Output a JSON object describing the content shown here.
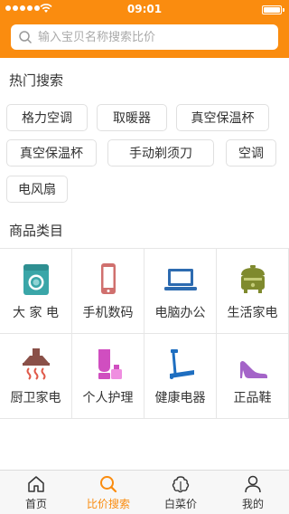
{
  "status": {
    "time": "09:01"
  },
  "search": {
    "placeholder": "输入宝贝名称搜索比价"
  },
  "hot": {
    "title": "热门搜索",
    "items": [
      "格力空调",
      "取暖器",
      "真空保温杯",
      "真空保温杯",
      "手动剃须刀",
      "空调",
      "电风扇"
    ]
  },
  "categories": {
    "title": "商品类目",
    "items": [
      {
        "label": "大 家 电",
        "icon": "washing-machine-icon",
        "color": "#3aa6a8"
      },
      {
        "label": "手机数码",
        "icon": "mobile-phone-icon",
        "color": "#d0706e"
      },
      {
        "label": "电脑办公",
        "icon": "laptop-icon",
        "color": "#2d6bb0"
      },
      {
        "label": "生活家电",
        "icon": "rice-cooker-icon",
        "color": "#7f8a2e"
      },
      {
        "label": "厨卫家电",
        "icon": "range-hood-icon",
        "color": "#8a5048"
      },
      {
        "label": "个人护理",
        "icon": "cosmetics-icon",
        "color": "#d04ec0"
      },
      {
        "label": "健康电器",
        "icon": "treadmill-icon",
        "color": "#1e6ec0"
      },
      {
        "label": "正品鞋",
        "icon": "high-heel-icon",
        "color": "#a464c8"
      }
    ]
  },
  "tabs": [
    {
      "label": "首页",
      "icon": "home-icon"
    },
    {
      "label": "比价搜索",
      "icon": "search-icon",
      "active": true
    },
    {
      "label": "白菜价",
      "icon": "cabbage-icon"
    },
    {
      "label": "我的",
      "icon": "user-icon"
    }
  ],
  "colors": {
    "brand": "#fa8c0f"
  }
}
